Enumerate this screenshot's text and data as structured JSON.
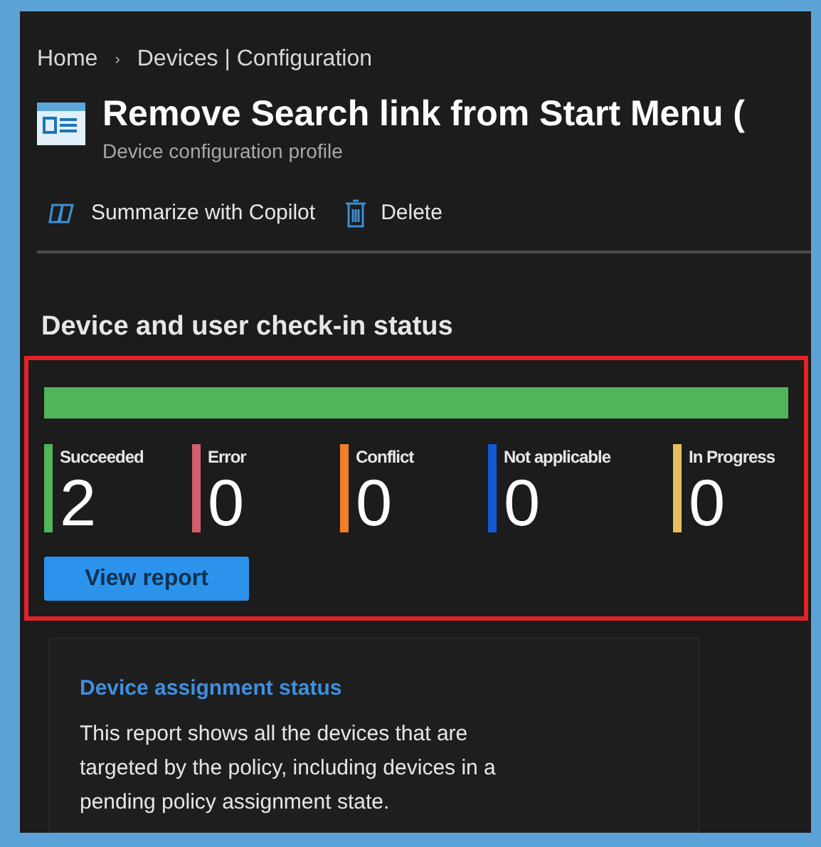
{
  "breadcrumb": [
    "Home",
    "›",
    "Devices | Configuration"
  ],
  "header": {
    "title": "Remove Search link from Start Menu (",
    "subtitle": "Device configuration profile"
  },
  "toolbar": [
    "Summarize with Copilot",
    "Delete"
  ],
  "checkin_status": {
    "heading": "Device and user check-in status",
    "bar": {
      "color": "#4fb557"
    },
    "statuses": [
      {
        "label": "Succeeded",
        "count": "2",
        "color": "#4fb557"
      },
      {
        "label": "Error",
        "count": "0",
        "color": "#d0606e"
      },
      {
        "label": "Conflict",
        "count": "0",
        "color": "#f07f2c"
      },
      {
        "label": "Not applicable",
        "count": "0",
        "color": "#1458d2"
      },
      {
        "label": "In Progress",
        "count": "0",
        "color": "#e3c15a"
      }
    ],
    "button": "View report"
  },
  "assignment_card": {
    "title": "Device assignment status",
    "description": "This report shows all the devices that are targeted by the policy, including devices in a pending policy assignment state."
  }
}
